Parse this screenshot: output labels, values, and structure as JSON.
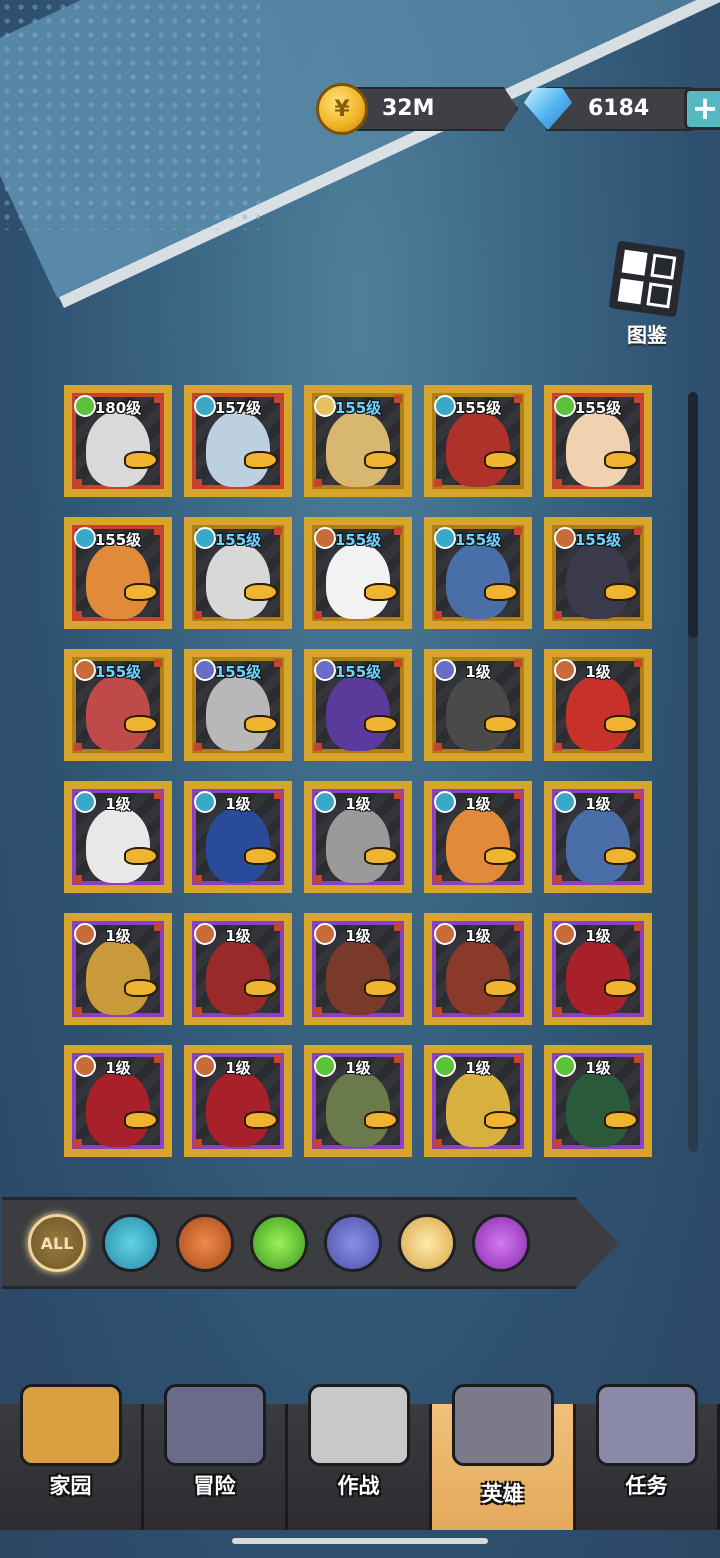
{
  "currency": {
    "coins": "32M",
    "coin_icon": "coin-icon",
    "gems": "6184",
    "gem_icon": "diamond-icon"
  },
  "codex": {
    "label": "图鉴"
  },
  "colors": {
    "rare_red": "#c8412f",
    "gold": "#d8a52c",
    "epic_purple": "#8a3fc7",
    "level_blue": "#6fd3ff"
  },
  "heroes": [
    {
      "level": "180级",
      "element": "nature",
      "frame": "red",
      "tint": "#d9d9d9",
      "lvl_color": "white"
    },
    {
      "level": "157级",
      "element": "mech",
      "frame": "red",
      "tint": "#bcd0e0",
      "lvl_color": "white"
    },
    {
      "level": "155级",
      "element": "light",
      "frame": "gold",
      "tint": "#d8b870",
      "lvl_color": "blue"
    },
    {
      "level": "155级",
      "element": "mech",
      "frame": "gold",
      "tint": "#b0302a",
      "lvl_color": "white"
    },
    {
      "level": "155级",
      "element": "nature",
      "frame": "red",
      "tint": "#f0d2b0",
      "lvl_color": "white"
    },
    {
      "level": "155级",
      "element": "mech",
      "frame": "red",
      "tint": "#e08a3a",
      "lvl_color": "white"
    },
    {
      "level": "155级",
      "element": "mech",
      "frame": "gold",
      "tint": "#d8d8d8",
      "lvl_color": "blue"
    },
    {
      "level": "155级",
      "element": "melee",
      "frame": "gold",
      "tint": "#f2f2f2",
      "lvl_color": "blue"
    },
    {
      "level": "155级",
      "element": "mech",
      "frame": "gold",
      "tint": "#4a6fa8",
      "lvl_color": "blue"
    },
    {
      "level": "155级",
      "element": "melee",
      "frame": "gold",
      "tint": "#3a3a4a",
      "lvl_color": "blue"
    },
    {
      "level": "155级",
      "element": "melee",
      "frame": "gold",
      "tint": "#c04a4a",
      "lvl_color": "blue"
    },
    {
      "level": "155级",
      "element": "bio",
      "frame": "gold",
      "tint": "#b8b8b8",
      "lvl_color": "blue"
    },
    {
      "level": "155级",
      "element": "bio",
      "frame": "gold",
      "tint": "#5a3a9a",
      "lvl_color": "blue"
    },
    {
      "level": "1级",
      "element": "bio",
      "frame": "gold",
      "tint": "#4a4a48",
      "lvl_color": "white"
    },
    {
      "level": "1级",
      "element": "melee",
      "frame": "gold",
      "tint": "#c8302a",
      "lvl_color": "white"
    },
    {
      "level": "1级",
      "element": "mech",
      "frame": "purple",
      "tint": "#e8e8e8",
      "lvl_color": "white"
    },
    {
      "level": "1级",
      "element": "mech",
      "frame": "purple",
      "tint": "#2a4a9a",
      "lvl_color": "white"
    },
    {
      "level": "1级",
      "element": "mech",
      "frame": "purple",
      "tint": "#9a9a9a",
      "lvl_color": "white"
    },
    {
      "level": "1级",
      "element": "mech",
      "frame": "purple",
      "tint": "#e08a3a",
      "lvl_color": "white"
    },
    {
      "level": "1级",
      "element": "mech",
      "frame": "purple",
      "tint": "#4a6fa8",
      "lvl_color": "white"
    },
    {
      "level": "1级",
      "element": "melee",
      "frame": "purple",
      "tint": "#c89a3a",
      "lvl_color": "white"
    },
    {
      "level": "1级",
      "element": "melee",
      "frame": "purple",
      "tint": "#9a2a2a",
      "lvl_color": "white"
    },
    {
      "level": "1级",
      "element": "melee",
      "frame": "purple",
      "tint": "#7a3a2a",
      "lvl_color": "white"
    },
    {
      "level": "1级",
      "element": "melee",
      "frame": "purple",
      "tint": "#8a3a2a",
      "lvl_color": "white"
    },
    {
      "level": "1级",
      "element": "melee",
      "frame": "purple",
      "tint": "#a8202a",
      "lvl_color": "white"
    },
    {
      "level": "1级",
      "element": "melee",
      "frame": "purple",
      "tint": "#a8202a",
      "lvl_color": "white"
    },
    {
      "level": "1级",
      "element": "melee",
      "frame": "purple",
      "tint": "#a8202a",
      "lvl_color": "white"
    },
    {
      "level": "1级",
      "element": "nature",
      "frame": "purple",
      "tint": "#6a7a4a",
      "lvl_color": "white"
    },
    {
      "level": "1级",
      "element": "nature",
      "frame": "purple",
      "tint": "#d8b040",
      "lvl_color": "white"
    },
    {
      "level": "1级",
      "element": "nature",
      "frame": "purple",
      "tint": "#2a5a3a",
      "lvl_color": "white"
    }
  ],
  "filters": [
    {
      "label": "ALL",
      "icon": "all-filter",
      "cls": "f-all"
    },
    {
      "label": "",
      "icon": "mech-filter-icon",
      "cls": "f-mech"
    },
    {
      "label": "",
      "icon": "melee-filter-icon",
      "cls": "f-melee"
    },
    {
      "label": "",
      "icon": "nature-filter-icon",
      "cls": "f-nature"
    },
    {
      "label": "",
      "icon": "biohazard-filter-icon",
      "cls": "f-bio"
    },
    {
      "label": "",
      "icon": "light-filter-icon",
      "cls": "f-light"
    },
    {
      "label": "",
      "icon": "arcane-filter-icon",
      "cls": "f-arcane"
    }
  ],
  "nav": [
    {
      "label": "家园",
      "icon": "home-castle-icon",
      "color": "#d8a040",
      "active": false
    },
    {
      "label": "冒险",
      "icon": "adventure-duck-icon",
      "color": "#6a6a8a",
      "active": false
    },
    {
      "label": "作战",
      "icon": "battle-swords-icon",
      "color": "#c8c8c8",
      "active": false
    },
    {
      "label": "英雄",
      "icon": "hero-book-icon",
      "color": "#7a7a8a",
      "active": true
    },
    {
      "label": "任务",
      "icon": "quest-scroll-icon",
      "color": "#8a8aa8",
      "active": false
    }
  ]
}
